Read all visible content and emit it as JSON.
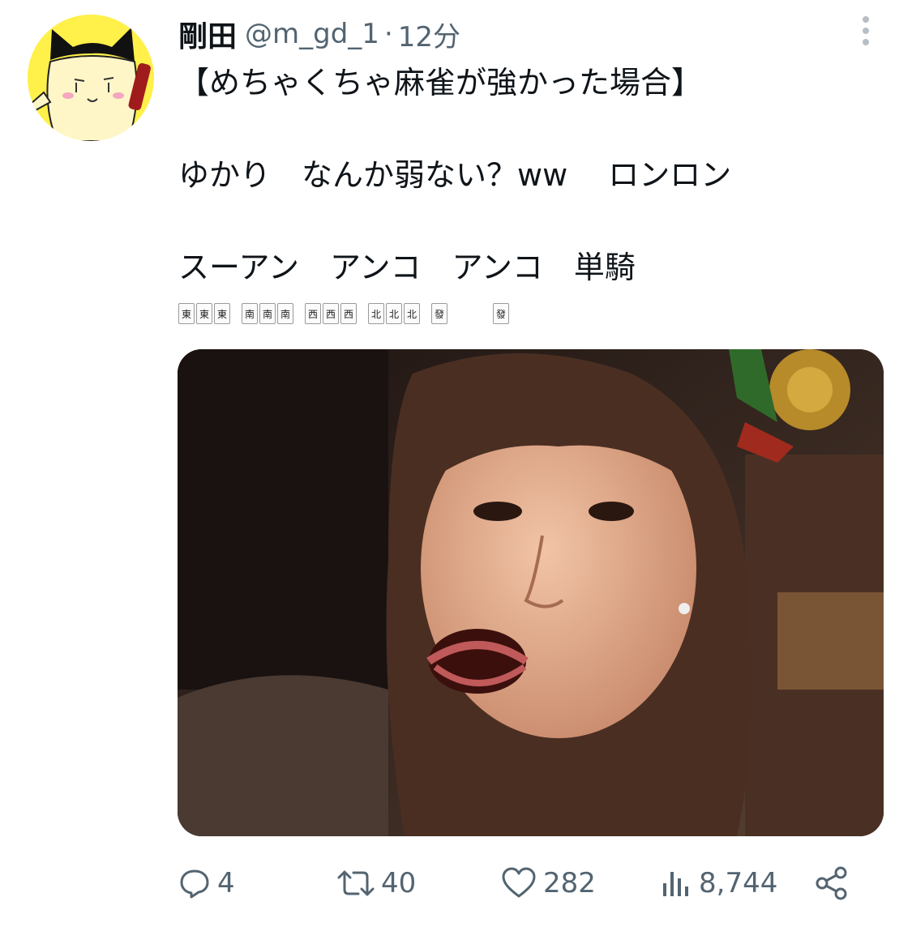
{
  "tweet": {
    "author": {
      "display_name": "剛田",
      "handle": "@m_gd_1",
      "separator": "·",
      "time": "12分"
    },
    "text_lines": [
      "【めちゃくちゃ麻雀が強かった場合】",
      "ゆかり　なんか弱ない？ww　 ロンロン",
      "スーアン　アンコ　アンコ　単騎"
    ],
    "tiles": {
      "east": "東",
      "south": "南",
      "west": "西",
      "north": "北",
      "green_dragon": "發"
    },
    "media": {
      "alt": "photo of surprised woman"
    },
    "actions": {
      "replies": "4",
      "retweets": "40",
      "likes": "282",
      "views": "8,744"
    },
    "icons": [
      "more-icon",
      "reply-icon",
      "retweet-icon",
      "like-icon",
      "views-icon",
      "share-icon"
    ],
    "colors": {
      "text": "#0f1419",
      "secondary": "#536471",
      "avatar_bg": "#fff04a"
    }
  }
}
